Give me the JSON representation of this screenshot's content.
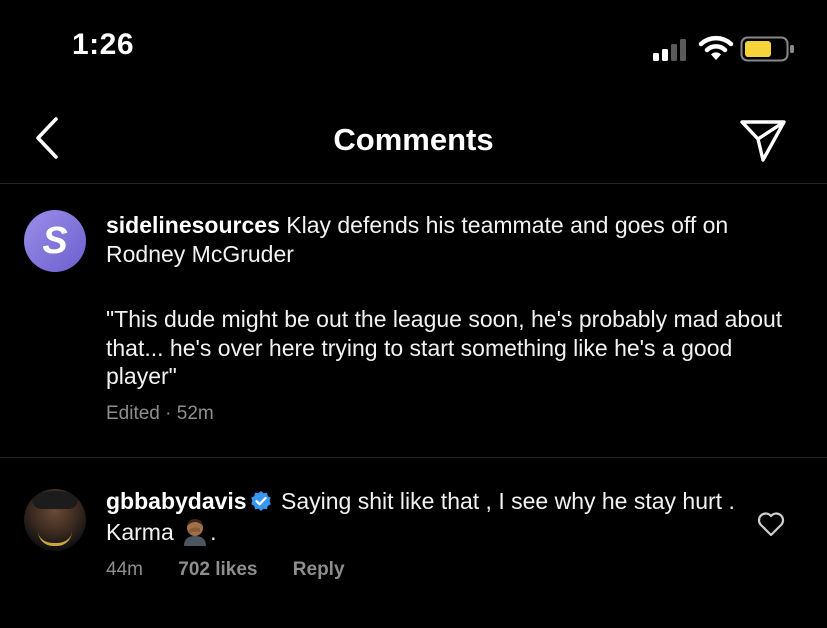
{
  "status": {
    "time": "1:26",
    "battery_color": "#f5d33a"
  },
  "nav": {
    "title": "Comments",
    "back_icon": "chevron-left-icon",
    "share_icon": "send-icon"
  },
  "post": {
    "avatar_letter": "S",
    "username": "sidelinesources",
    "caption": "Klay defends his teammate and goes off on Rodney McGruder",
    "quote": "\"This dude might be out the league soon, he's probably mad about that... he's over here trying to start something like he's a good player\"",
    "meta": "Edited · 52m"
  },
  "comment": {
    "username": "gbbabydavis",
    "verified": true,
    "text_before": "Saying shit like that , I see why he stay hurt .  Karma",
    "text_after": ".",
    "emoji": "man-facepalming-emoji",
    "time": "44m",
    "likes": "702 likes",
    "reply": "Reply"
  },
  "colors": {
    "background": "#000000",
    "meta_text": "#8e8e8e",
    "verified_badge": "#3897f0",
    "avatar_s": "#7b6fd9"
  }
}
